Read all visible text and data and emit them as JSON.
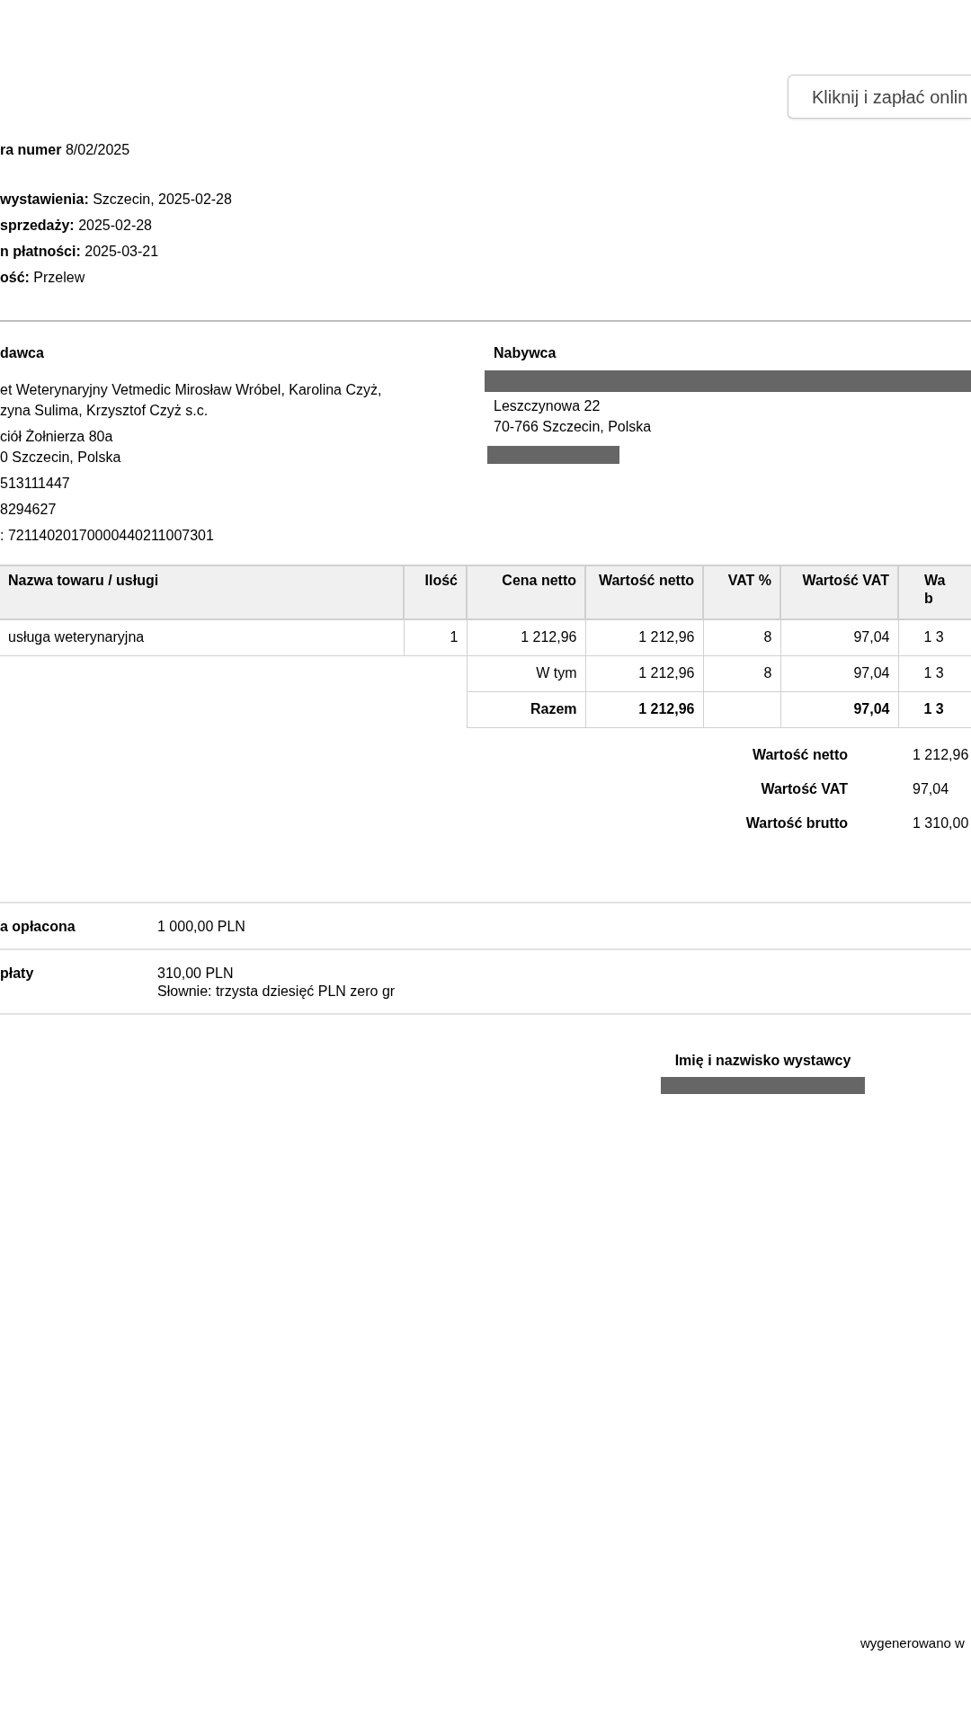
{
  "pay_button": "Kliknij i zapłać onlin",
  "invoice": {
    "number_label": "ra numer",
    "number": "8/02/2025",
    "details": [
      {
        "label": "wystawienia:",
        "value": "Szczecin, 2025-02-28"
      },
      {
        "label": "sprzedaży:",
        "value": "2025-02-28"
      },
      {
        "label": "n płatności:",
        "value": "2025-03-21"
      },
      {
        "label": "ość:",
        "value": "Przelew"
      }
    ]
  },
  "seller": {
    "heading": "dawca",
    "name_lines": [
      "et Weterynaryjny Vetmedic Mirosław Wróbel, Karolina Czyż,",
      "zyna Sulima, Krzysztof Czyż s.c."
    ],
    "address_lines": [
      "ciół Żołnierza 80a",
      "0 Szczecin, Polska"
    ],
    "other_lines": [
      "513111447",
      "8294627",
      ": 72114020170000440211007301"
    ]
  },
  "buyer": {
    "heading": "Nabywca",
    "address_lines": [
      "Leszczynowa 22",
      "70-766 Szczecin, Polska"
    ]
  },
  "table": {
    "columns": [
      "Nazwa towaru / usługi",
      "Ilość",
      "Cena netto",
      "Wartość netto",
      "VAT %",
      "Wartość VAT",
      "Wa\nb"
    ],
    "rows": [
      [
        "usługa weterynaryjna",
        "1",
        "1 212,96",
        "1 212,96",
        "8",
        "97,04",
        "1 3"
      ]
    ],
    "summary_rows": [
      {
        "kind": "subtotal",
        "cells": [
          "W tym",
          "1 212,96",
          "8",
          "97,04",
          "1 3"
        ]
      },
      {
        "kind": "total",
        "cells": [
          "Razem",
          "1 212,96",
          null,
          "97,04",
          "1 3"
        ]
      }
    ]
  },
  "totals": [
    {
      "label": "Wartość netto",
      "value": "1 212,96"
    },
    {
      "label": "Wartość VAT",
      "value": "97,04"
    },
    {
      "label": "Wartość brutto",
      "value": "1 310,00"
    }
  ],
  "payments": [
    {
      "label": "a opłacona",
      "lines": [
        "1 000,00 PLN"
      ]
    },
    {
      "label": "płaty",
      "lines": [
        "310,00 PLN",
        "Słownie: trzysta dziesięć PLN zero gr"
      ]
    }
  ],
  "signature": {
    "label": "Imię i nazwisko wystawcy"
  },
  "footer": "wygenerowano w"
}
